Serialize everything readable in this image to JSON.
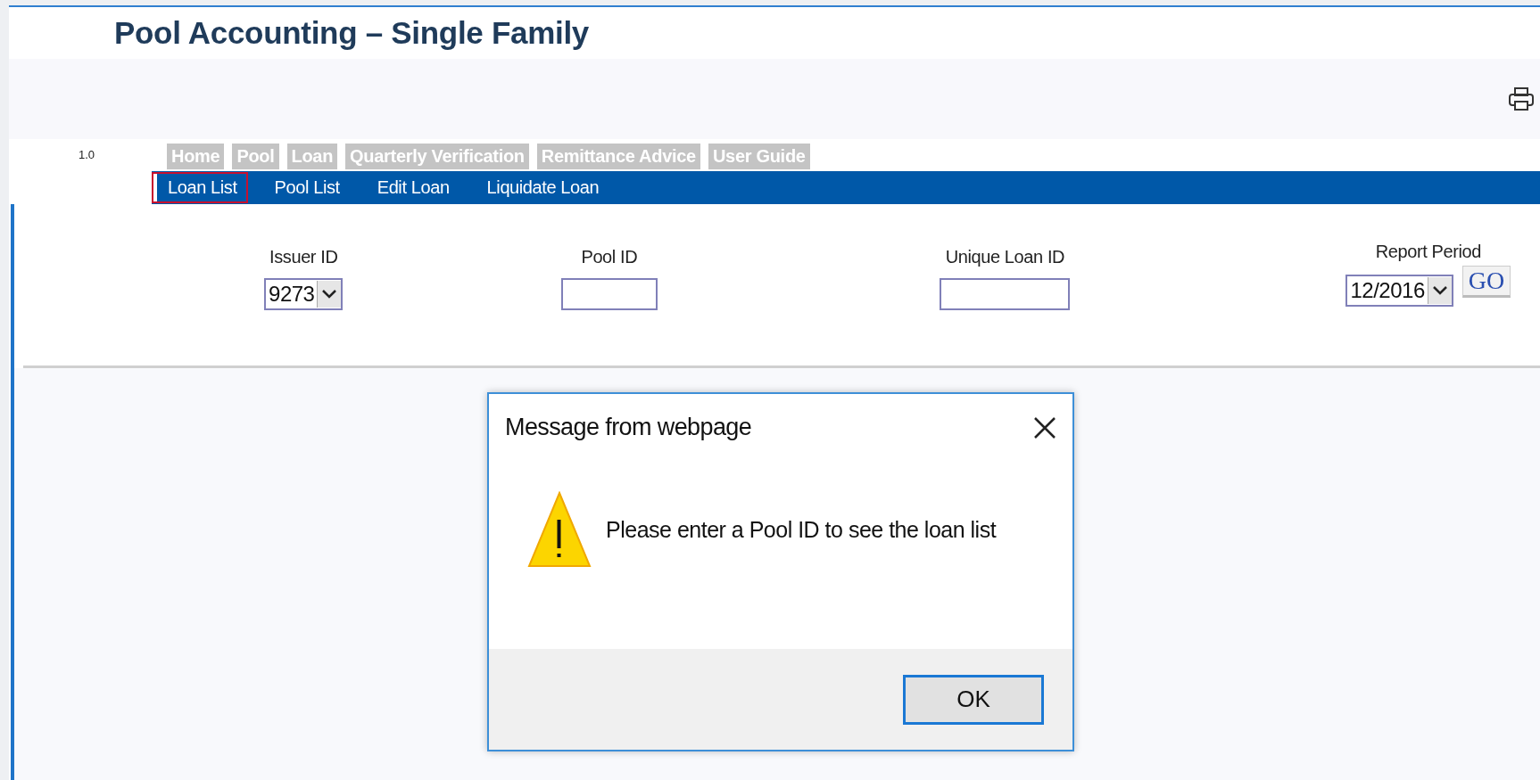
{
  "header": {
    "title": "Pool Accounting – Single Family"
  },
  "version": "1.0",
  "tabs": [
    {
      "label": "Home"
    },
    {
      "label": "Pool"
    },
    {
      "label": "Loan"
    },
    {
      "label": "Quarterly Verification"
    },
    {
      "label": "Remittance Advice"
    },
    {
      "label": "User Guide"
    }
  ],
  "subnav": [
    {
      "label": "Loan List",
      "selected": true
    },
    {
      "label": "Pool List",
      "selected": false
    },
    {
      "label": "Edit Loan",
      "selected": false
    },
    {
      "label": "Liquidate Loan",
      "selected": false
    }
  ],
  "filters": [
    {
      "kind": "select",
      "label": "Issuer ID",
      "value": "9273"
    },
    {
      "kind": "text",
      "label": "Pool ID"
    },
    {
      "kind": "text",
      "label": "Unique Loan ID"
    },
    {
      "kind": "select",
      "label": "Report Period",
      "value": "12/2016"
    }
  ],
  "go_button": "GO",
  "dialog": {
    "title": "Message from webpage",
    "message": "Please enter a Pool ID to see the loan list",
    "buttons": [
      "OK"
    ]
  }
}
